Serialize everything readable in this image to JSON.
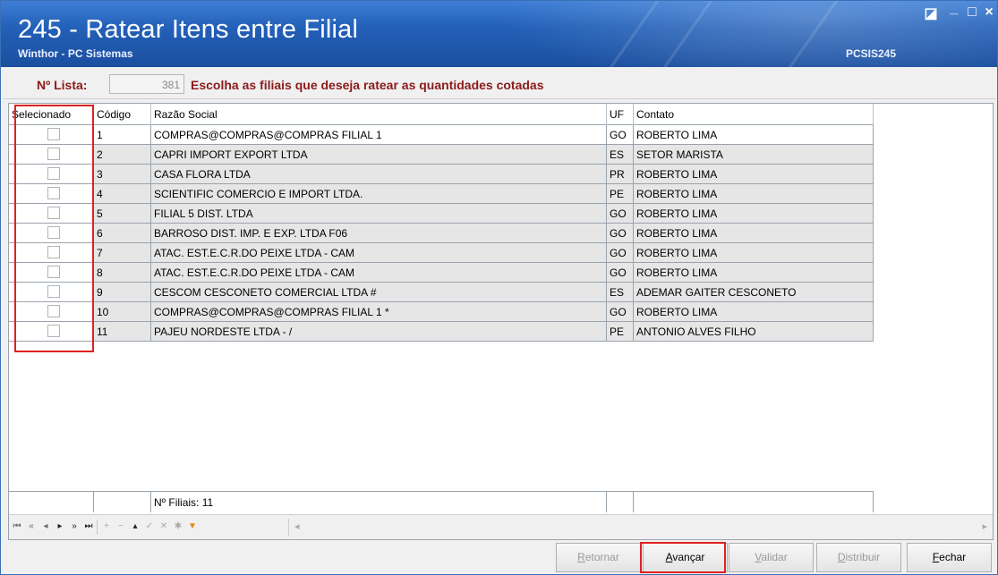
{
  "window": {
    "title": "245 - Ratear Itens entre Filial",
    "subtitle": "Winthor - PC Sistemas",
    "routine_code": "PCSIS245",
    "controls": {
      "restore": "◪",
      "minimize": "_",
      "maximize": "□",
      "close": "×"
    }
  },
  "list_bar": {
    "label": "Nº Lista:",
    "value": "381",
    "message": "Escolha as filiais que deseja ratear as quantidades cotadas"
  },
  "grid": {
    "columns": [
      "Selecionado",
      "Código",
      "Razão Social",
      "UF",
      "Contato"
    ],
    "rows": [
      {
        "selected": false,
        "codigo": "1",
        "razao_social": "COMPRAS@COMPRAS@COMPRAS FILIAL 1",
        "uf": "GO",
        "contato": "ROBERTO LIMA"
      },
      {
        "selected": false,
        "codigo": "2",
        "razao_social": "CAPRI IMPORT  EXPORT LTDA",
        "uf": "ES",
        "contato": "SETOR MARISTA"
      },
      {
        "selected": false,
        "codigo": "3",
        "razao_social": "CASA FLORA LTDA",
        "uf": "PR",
        "contato": "ROBERTO LIMA"
      },
      {
        "selected": false,
        "codigo": "4",
        "razao_social": "SCIENTIFIC COMERCIO E IMPORT LTDA.",
        "uf": "PE",
        "contato": "ROBERTO LIMA"
      },
      {
        "selected": false,
        "codigo": "5",
        "razao_social": "FILIAL 5  DIST. LTDA",
        "uf": "GO",
        "contato": "ROBERTO LIMA"
      },
      {
        "selected": false,
        "codigo": "6",
        "razao_social": "BARROSO DIST. IMP. E EXP. LTDA  F06",
        "uf": "GO",
        "contato": "ROBERTO LIMA"
      },
      {
        "selected": false,
        "codigo": "7",
        "razao_social": "ATAC. EST.E.C.R.DO PEIXE LTDA - CAM",
        "uf": "GO",
        "contato": "ROBERTO LIMA"
      },
      {
        "selected": false,
        "codigo": "8",
        "razao_social": "ATAC. EST.E.C.R.DO PEIXE LTDA - CAM",
        "uf": "GO",
        "contato": "ROBERTO LIMA"
      },
      {
        "selected": false,
        "codigo": "9",
        "razao_social": "CESCOM CESCONETO COMERCIAL LTDA #",
        "uf": "ES",
        "contato": "ADEMAR GAITER CESCONETO"
      },
      {
        "selected": false,
        "codigo": "10",
        "razao_social": "COMPRAS@COMPRAS@COMPRAS FILIAL 1 *",
        "uf": "GO",
        "contato": "ROBERTO LIMA"
      },
      {
        "selected": false,
        "codigo": "11",
        "razao_social": "PAJEU NORDESTE LTDA - /",
        "uf": "PE",
        "contato": "ANTONIO  ALVES FILHO"
      }
    ],
    "footer_summary": "Nº Filiais: 11"
  },
  "navigator": {
    "buttons": [
      "first-page",
      "prior-page",
      "prior",
      "next",
      "next-page",
      "last",
      "insert",
      "delete",
      "edit",
      "post",
      "cancel",
      "refresh",
      "filter"
    ]
  },
  "buttons": {
    "retornar": {
      "pre": "",
      "key": "R",
      "post": "etornar"
    },
    "avancar": {
      "pre": "",
      "key": "A",
      "post": "vançar"
    },
    "validar": {
      "pre": "",
      "key": "V",
      "post": "alidar"
    },
    "distribuir": {
      "pre": "",
      "key": "D",
      "post": "istribuir"
    },
    "fechar": {
      "pre": "",
      "key": "F",
      "post": "echar"
    }
  },
  "colors": {
    "title_bar": "#2360b8",
    "label_red": "#8b1a1a",
    "highlight": "#e02020"
  }
}
